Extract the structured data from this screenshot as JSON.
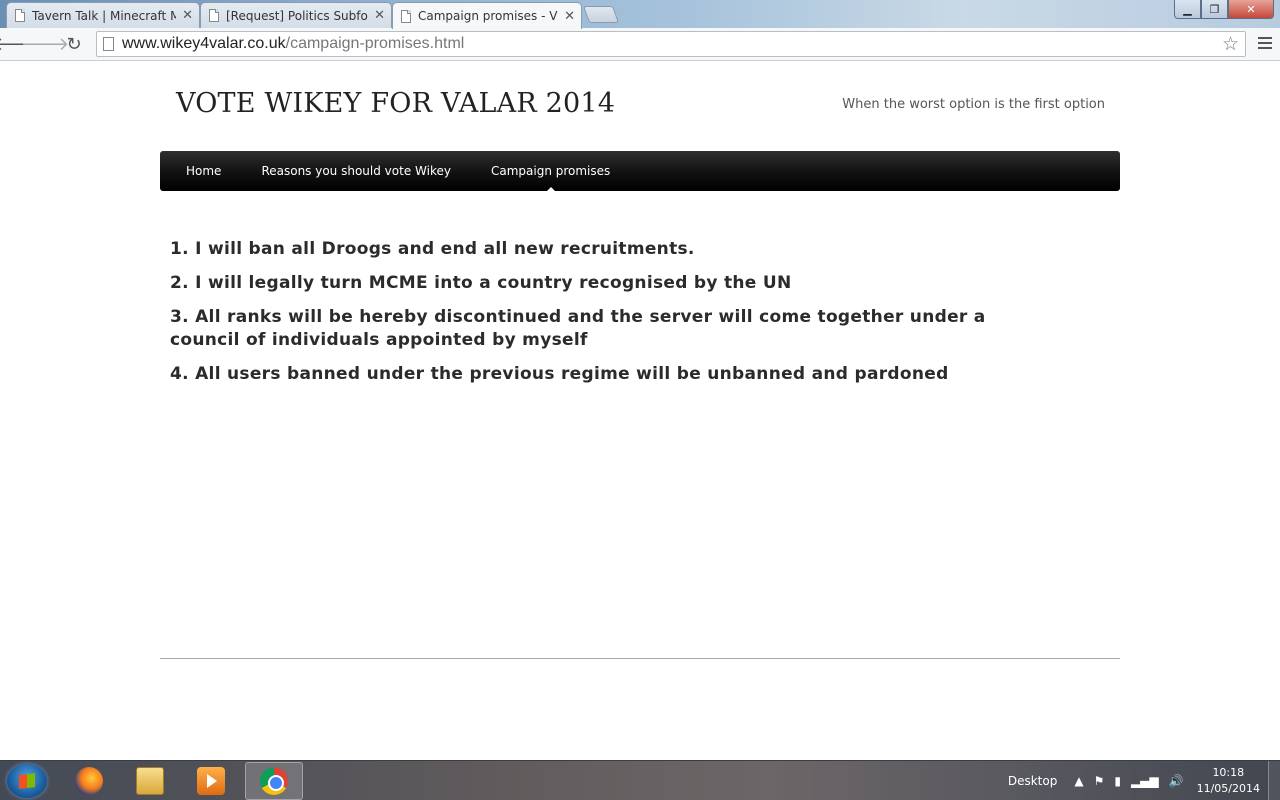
{
  "browser": {
    "tabs": [
      {
        "title": "Tavern Talk | Minecraft M",
        "active": false
      },
      {
        "title": "[Request] Politics Subforu",
        "active": false
      },
      {
        "title": "Campaign promises - VOT",
        "active": true
      }
    ],
    "url_host": "www.wikey4valar.co.uk",
    "url_path": "/campaign-promises.html",
    "icons": [
      "back-icon",
      "forward-icon",
      "reload-icon",
      "page-icon",
      "star-icon",
      "menu-icon"
    ]
  },
  "site": {
    "title": "VOTE WIKEY FOR VALAR 2014",
    "tagline": "When the worst option is the first option",
    "nav": [
      {
        "label": "Home",
        "active": false
      },
      {
        "label": "Reasons you should vote Wikey",
        "active": false
      },
      {
        "label": "Campaign promises",
        "active": true
      }
    ],
    "promises": [
      "1. I will ban all Droogs and end all new recruitments.",
      "2. I will legally turn MCME into a country recognised by the UN",
      "3. All ranks will be hereby discontinued and the server will come together under a council of individuals appointed by myself",
      "4. All users banned under the previous regime will be unbanned and pardoned"
    ]
  },
  "taskbar": {
    "desktop_label": "Desktop",
    "time": "10:18",
    "date": "11/05/2014",
    "apps": [
      "firefox",
      "windows-explorer",
      "media-player",
      "chrome"
    ]
  }
}
